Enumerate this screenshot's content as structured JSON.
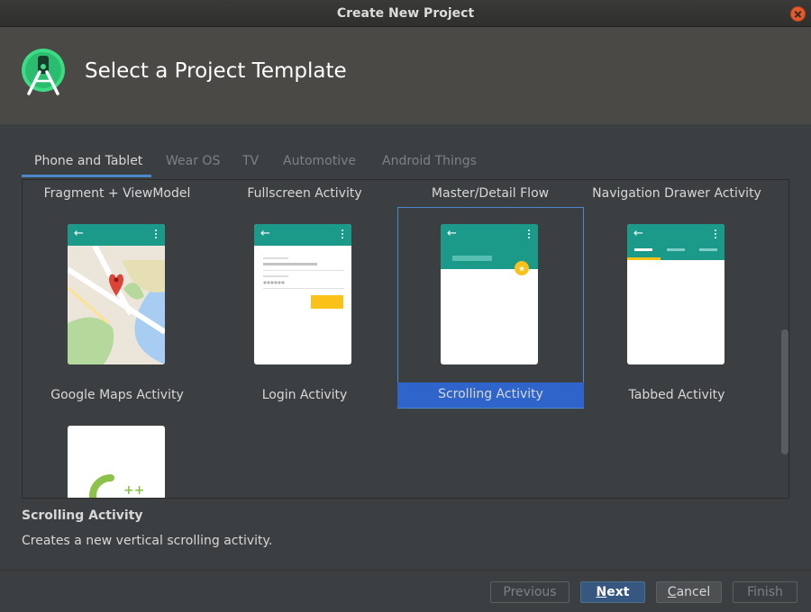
{
  "window": {
    "title": "Create New Project"
  },
  "header": {
    "heading": "Select a Project Template",
    "logo_icon": "android-studio-logo-icon"
  },
  "tabs": [
    {
      "label": "Phone and Tablet",
      "active": true
    },
    {
      "label": "Wear OS",
      "active": false
    },
    {
      "label": "TV",
      "active": false
    },
    {
      "label": "Automotive",
      "active": false
    },
    {
      "label": "Android Things",
      "active": false
    }
  ],
  "templates": {
    "top_labels": [
      "Fragment + ViewModel",
      "Fullscreen Activity",
      "Master/Detail Flow",
      "Navigation Drawer Activity"
    ],
    "items": [
      {
        "label": "Google Maps Activity",
        "preview_icon": "map-preview-icon"
      },
      {
        "label": "Login Activity",
        "preview_icon": "login-form-preview-icon"
      },
      {
        "label": "Scrolling Activity",
        "preview_icon": "scrolling-preview-icon",
        "selected": true
      },
      {
        "label": "Tabbed Activity",
        "preview_icon": "tabs-preview-icon"
      }
    ],
    "partial_item": {
      "preview_icon": "cpp-logo-icon",
      "text": "++"
    }
  },
  "description": {
    "title": "Scrolling Activity",
    "text": "Creates a new vertical scrolling activity."
  },
  "footer": {
    "previous_label": "Previous",
    "next_label": "Next",
    "cancel_label": "Cancel",
    "finish_label": "Finish"
  },
  "colors": {
    "accent": "#4a88c7",
    "selection": "#2f65ca",
    "appbar_teal": "#1b9a8a",
    "fab_yellow": "#fbc11b",
    "primary_button": "#365880"
  }
}
